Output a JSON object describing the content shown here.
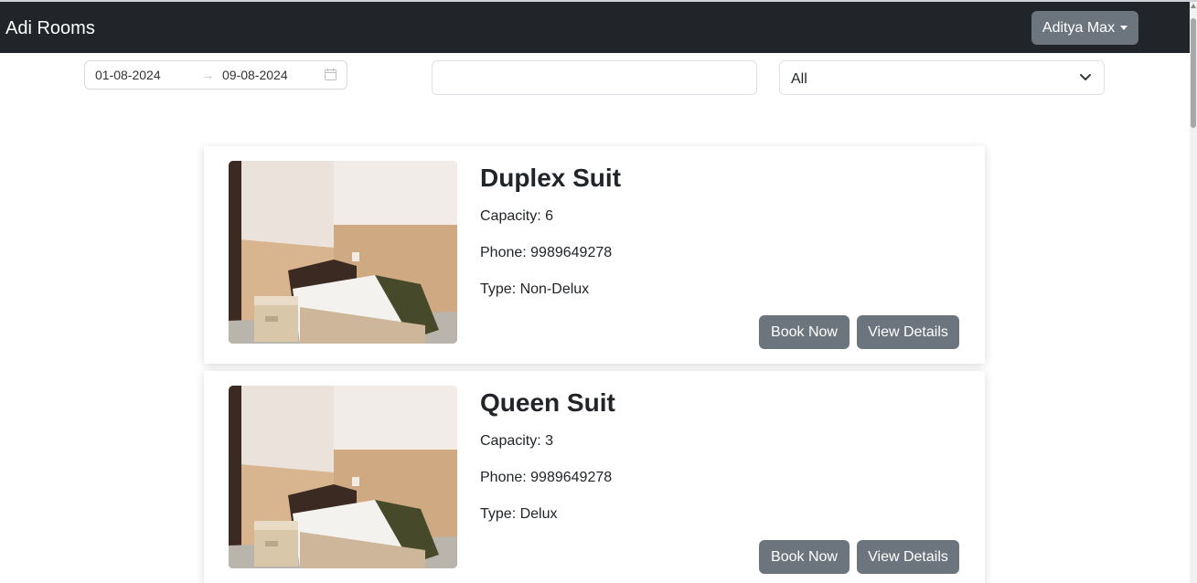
{
  "navbar": {
    "brand": "Adi Rooms",
    "user_menu_label": "Aditya Max"
  },
  "filters": {
    "date_start": "01-08-2024",
    "date_arrow": "→",
    "date_end": "09-08-2024",
    "search_value": "",
    "type_selected": "All"
  },
  "rooms": [
    {
      "title": "Duplex Suit",
      "capacity": "Capacity: 6",
      "phone": "Phone: 9989649278",
      "type": "Type: Non-Delux",
      "book_label": "Book Now",
      "view_label": "View Details"
    },
    {
      "title": "Queen Suit",
      "capacity": "Capacity: 3",
      "phone": "Phone: 9989649278",
      "type": "Type: Delux",
      "book_label": "Book Now",
      "view_label": "View Details"
    }
  ],
  "colors": {
    "navbar_bg": "#212529",
    "button_bg": "#6c757d"
  },
  "icons": [
    "calendar-icon",
    "chevron-down-icon",
    "caret-down-icon"
  ]
}
